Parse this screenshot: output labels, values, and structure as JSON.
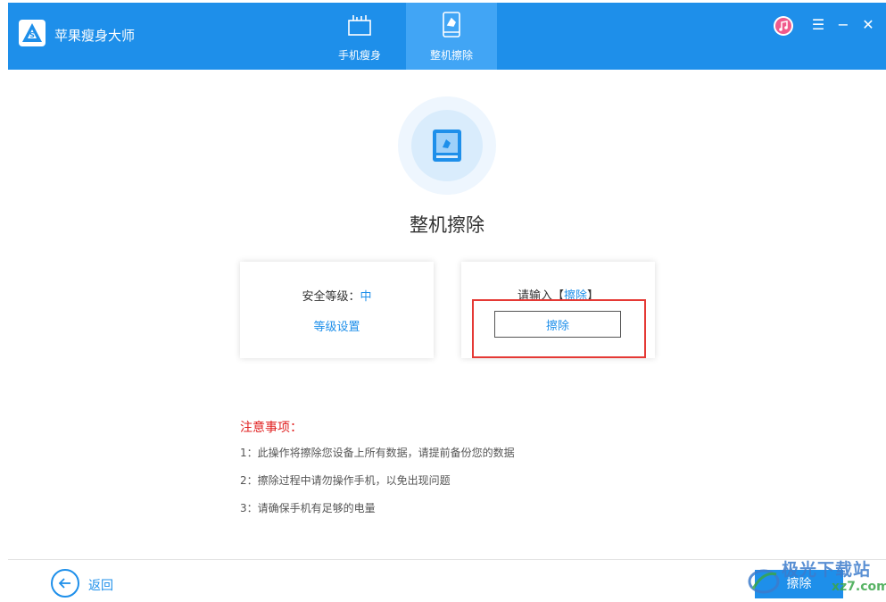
{
  "app": {
    "title": "苹果瘦身大师"
  },
  "tabs": [
    {
      "label": "手机瘦身",
      "icon": "broom-icon"
    },
    {
      "label": "整机擦除",
      "icon": "phone-erase-icon"
    }
  ],
  "window_controls": {
    "itunes": "itunes-icon",
    "menu": "☰",
    "minimize": "−",
    "close": "✕"
  },
  "main": {
    "title": "整机擦除",
    "security": {
      "label": "安全等级：",
      "value": "中",
      "link": "等级设置"
    },
    "confirm": {
      "prefix": "请输入【",
      "keyword": "擦除",
      "suffix": "】",
      "value": "擦除"
    },
    "notes": {
      "title": "注意事项：",
      "items": [
        "1：此操作将擦除您设备上所有数据，请提前备份您的数据",
        "2：擦除过程中请勿操作手机，以免出现问题",
        "3：请确保手机有足够的电量"
      ]
    }
  },
  "footer": {
    "back_label": "返回",
    "erase_label": "擦除"
  },
  "watermark": {
    "text": "极光下载站",
    "sub": "xz7.com"
  },
  "colors": {
    "accent": "#1e8fea",
    "warning": "#e02020",
    "highlight": "#e53935"
  }
}
